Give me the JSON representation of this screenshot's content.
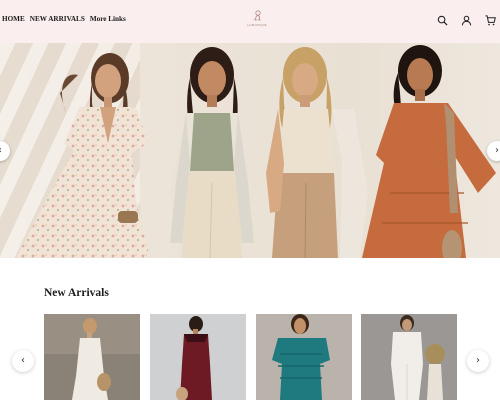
{
  "header": {
    "nav": [
      {
        "label": "HOME"
      },
      {
        "label": "NEW ARRIVALS"
      },
      {
        "label": "More Links"
      }
    ],
    "logo_text": "LA BOUTIQUE",
    "icons": [
      "search-icon",
      "account-icon",
      "cart-icon"
    ]
  },
  "hero": {
    "prev_icon": "‹",
    "next_icon": "›",
    "models": [
      "floral-wrap-dress",
      "sage-tank-cream-trousers",
      "cream-tank-tan-trousers",
      "rust-tiered-dress"
    ]
  },
  "new_arrivals": {
    "title": "New Arrivals",
    "prev_icon": "‹",
    "next_icon": "›",
    "products": [
      {
        "name": "white-maxi-dress"
      },
      {
        "name": "burgundy-midi-dress"
      },
      {
        "name": "teal-fringe-dress"
      },
      {
        "name": "white-jumpsuit"
      }
    ]
  },
  "colors": {
    "header_bg": "#fbeeee",
    "text": "#1a1a1a"
  }
}
